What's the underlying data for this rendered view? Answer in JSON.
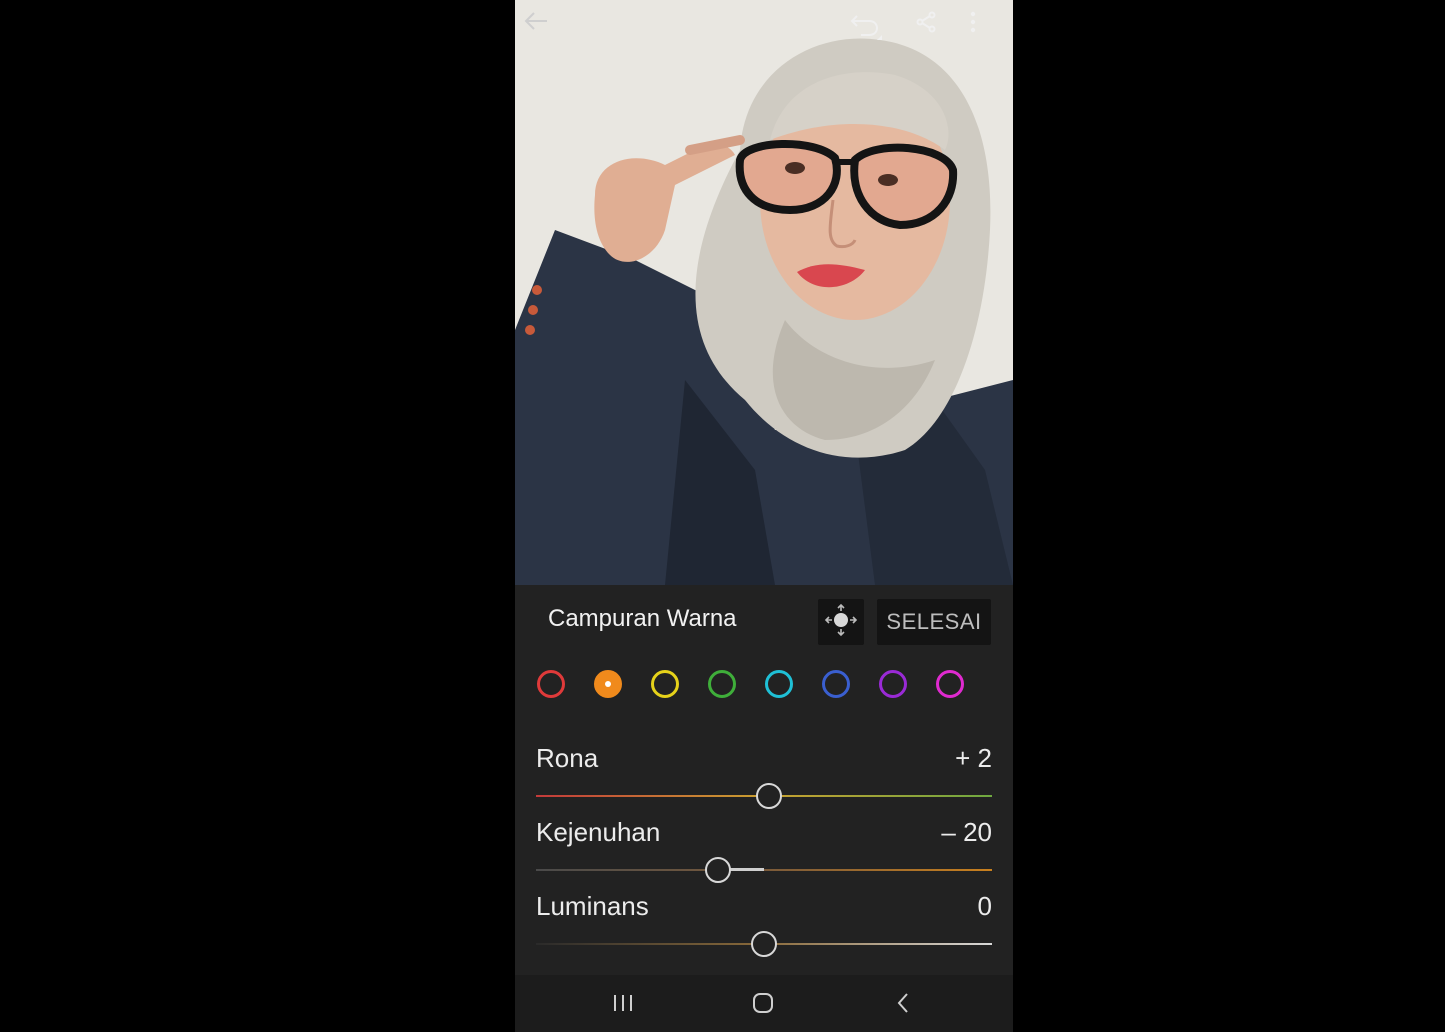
{
  "panel": {
    "title": "Campuran Warna",
    "done_label": "SELESAI",
    "target_icon": "target-adjust-icon"
  },
  "topbar": {
    "back_icon": "arrow-left-icon",
    "undo_icon": "undo-icon",
    "share_icon": "share-icon",
    "more_icon": "more-vertical-icon"
  },
  "swatches": [
    {
      "name": "red",
      "color": "#e03a3a",
      "selected": false
    },
    {
      "name": "orange",
      "color": "#f08a1c",
      "selected": true
    },
    {
      "name": "yellow",
      "color": "#e6d21a",
      "selected": false
    },
    {
      "name": "green",
      "color": "#3fae3a",
      "selected": false
    },
    {
      "name": "aqua",
      "color": "#1fc0d6",
      "selected": false
    },
    {
      "name": "blue",
      "color": "#3a5fd0",
      "selected": false
    },
    {
      "name": "purple",
      "color": "#9a2ad6",
      "selected": false
    },
    {
      "name": "magenta",
      "color": "#e02ad0",
      "selected": false
    }
  ],
  "sliders": [
    {
      "label": "Rona",
      "value_text": "+ 2",
      "value": 2,
      "min": -100,
      "max": 100
    },
    {
      "label": "Kejenuhan",
      "value_text": "– 20",
      "value": -20,
      "min": -100,
      "max": 100
    },
    {
      "label": "Luminans",
      "value_text": "0",
      "value": 0,
      "min": -100,
      "max": 100
    }
  ],
  "navbar": {
    "recents_icon": "recent-apps-icon",
    "home_icon": "home-icon",
    "back_icon": "nav-back-icon"
  }
}
